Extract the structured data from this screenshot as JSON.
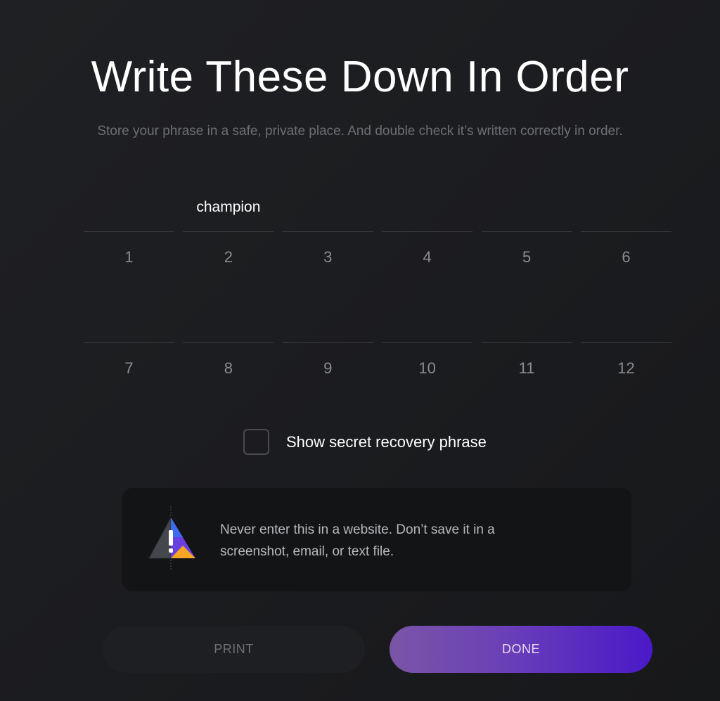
{
  "header": {
    "title": "Write These Down In Order",
    "subtitle": "Store your phrase in a safe, private place. And double check it’s written correctly in order."
  },
  "phrase": {
    "rows": [
      [
        {
          "number": "1",
          "word": ""
        },
        {
          "number": "2",
          "word": "champion"
        },
        {
          "number": "3",
          "word": ""
        },
        {
          "number": "4",
          "word": ""
        },
        {
          "number": "5",
          "word": ""
        },
        {
          "number": "6",
          "word": ""
        }
      ],
      [
        {
          "number": "7",
          "word": ""
        },
        {
          "number": "8",
          "word": ""
        },
        {
          "number": "9",
          "word": ""
        },
        {
          "number": "10",
          "word": ""
        },
        {
          "number": "11",
          "word": ""
        },
        {
          "number": "12",
          "word": ""
        }
      ]
    ]
  },
  "show_phrase": {
    "label": "Show secret recovery phrase",
    "checked": false
  },
  "warning": {
    "icon": "warning-triangle-icon",
    "text": "Never enter this in a website. Don’t save it in a screenshot, email, or text file."
  },
  "buttons": {
    "print_label": "PRINT",
    "done_label": "DONE"
  },
  "colors": {
    "accent_start": "#7a55a6",
    "accent_end": "#4a19c9",
    "warning_yellow": "#f5a623",
    "warning_blue": "#3d6cf0"
  }
}
